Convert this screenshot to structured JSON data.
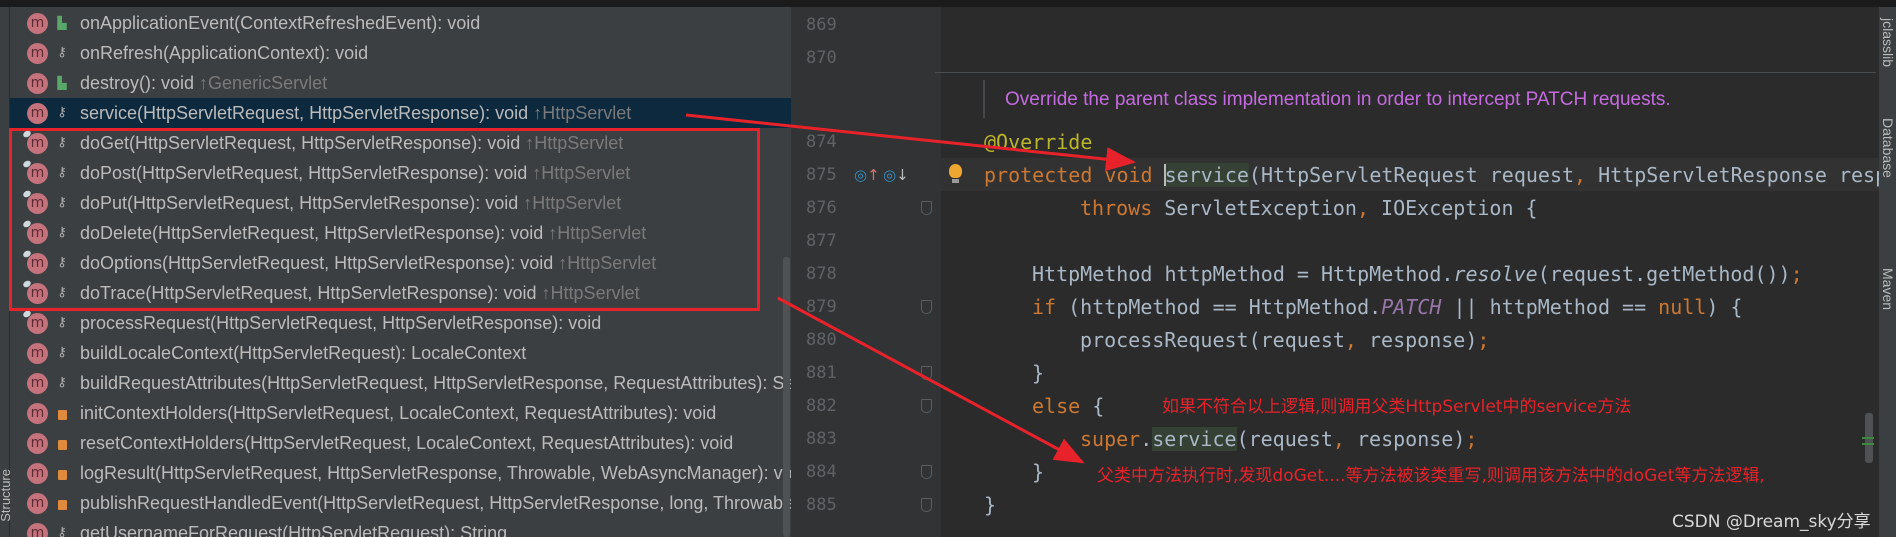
{
  "structure": {
    "side_tab": "Structure",
    "items": [
      {
        "name": "onApplicationEvent(ContextRefreshedEvent): void",
        "inherited": "",
        "access": "public",
        "overrides": false
      },
      {
        "name": "onRefresh(ApplicationContext): void",
        "inherited": "",
        "access": "protected",
        "overrides": false
      },
      {
        "name": "destroy(): void ",
        "inherited": "↑GenericServlet",
        "access": "public",
        "overrides": false
      },
      {
        "name": "service(HttpServletRequest, HttpServletResponse): void ",
        "inherited": "↑HttpServlet",
        "access": "protected",
        "overrides": false,
        "selected": true
      },
      {
        "name": "doGet(HttpServletRequest, HttpServletResponse): void ",
        "inherited": "↑HttpServlet",
        "access": "protected",
        "overrides": true
      },
      {
        "name": "doPost(HttpServletRequest, HttpServletResponse): void ",
        "inherited": "↑HttpServlet",
        "access": "protected",
        "overrides": true
      },
      {
        "name": "doPut(HttpServletRequest, HttpServletResponse): void ",
        "inherited": "↑HttpServlet",
        "access": "protected",
        "overrides": true
      },
      {
        "name": "doDelete(HttpServletRequest, HttpServletResponse): void ",
        "inherited": "↑HttpServlet",
        "access": "protected",
        "overrides": true
      },
      {
        "name": "doOptions(HttpServletRequest, HttpServletResponse): void ",
        "inherited": "↑HttpServlet",
        "access": "protected",
        "overrides": true
      },
      {
        "name": "doTrace(HttpServletRequest, HttpServletResponse): void ",
        "inherited": "↑HttpServlet",
        "access": "protected",
        "overrides": true
      },
      {
        "name": "processRequest(HttpServletRequest, HttpServletResponse): void",
        "inherited": "",
        "access": "protected",
        "overrides": true
      },
      {
        "name": "buildLocaleContext(HttpServletRequest): LocaleContext",
        "inherited": "",
        "access": "protected",
        "overrides": false
      },
      {
        "name": "buildRequestAttributes(HttpServletRequest, HttpServletResponse, RequestAttributes): ServletRequestAttributes",
        "inherited": "",
        "access": "protected",
        "overrides": false
      },
      {
        "name": "initContextHolders(HttpServletRequest, LocaleContext, RequestAttributes): void",
        "inherited": "",
        "access": "private",
        "overrides": false
      },
      {
        "name": "resetContextHolders(HttpServletRequest, LocaleContext, RequestAttributes): void",
        "inherited": "",
        "access": "private",
        "overrides": false
      },
      {
        "name": "logResult(HttpServletRequest, HttpServletResponse, Throwable, WebAsyncManager): void",
        "inherited": "",
        "access": "private",
        "overrides": false
      },
      {
        "name": "publishRequestHandledEvent(HttpServletRequest, HttpServletResponse, long, Throwable): void",
        "inherited": "",
        "access": "private",
        "overrides": false
      },
      {
        "name": "getUsernameForRequest(HttpServletRequest): String",
        "inherited": "",
        "access": "protected",
        "overrides": false
      }
    ]
  },
  "editor": {
    "doc_comment": "Override the parent class implementation in order to intercept PATCH requests.",
    "line_numbers": [
      {
        "n": "869",
        "row": 0
      },
      {
        "n": "870",
        "row": 1
      },
      {
        "n": "874",
        "row": 3.5
      },
      {
        "n": "875",
        "row": 4.5
      },
      {
        "n": "876",
        "row": 5.5
      },
      {
        "n": "877",
        "row": 6.5
      },
      {
        "n": "878",
        "row": 7.5
      },
      {
        "n": "879",
        "row": 8.5
      },
      {
        "n": "880",
        "row": 9.5
      },
      {
        "n": "881",
        "row": 10.5
      },
      {
        "n": "882",
        "row": 11.5
      },
      {
        "n": "883",
        "row": 12.5
      },
      {
        "n": "884",
        "row": 13.5
      },
      {
        "n": "885",
        "row": 14.5
      }
    ],
    "code": [
      {
        "row": 3.5,
        "indent": 0,
        "tokens": [
          [
            "@Override",
            "ann"
          ]
        ]
      },
      {
        "row": 4.5,
        "indent": 0,
        "tokens": [
          [
            "protected void ",
            "kw"
          ],
          [
            "service",
            "hl"
          ],
          [
            "(HttpServletRequest request",
            "id"
          ],
          [
            ", ",
            "kw"
          ],
          [
            "HttpServletResponse response",
            "id"
          ]
        ]
      },
      {
        "row": 5.5,
        "indent": 2,
        "tokens": [
          [
            "throws ",
            "kw"
          ],
          [
            "ServletException",
            "id"
          ],
          [
            ", ",
            "kw"
          ],
          [
            "IOException {",
            "id"
          ]
        ]
      },
      {
        "row": 7.5,
        "indent": 1,
        "tokens": [
          [
            "HttpMethod httpMethod = HttpMethod.",
            "id"
          ],
          [
            "resolve",
            "mit"
          ],
          [
            "(request.getMethod())",
            "id"
          ],
          [
            ";",
            "kw"
          ]
        ]
      },
      {
        "row": 8.5,
        "indent": 1,
        "tokens": [
          [
            "if ",
            "kw"
          ],
          [
            "(httpMethod == HttpMethod.",
            "id"
          ],
          [
            "PATCH",
            "it"
          ],
          [
            " || httpMethod == ",
            "id"
          ],
          [
            "null",
            "kw"
          ],
          [
            ") {",
            "id"
          ]
        ]
      },
      {
        "row": 9.5,
        "indent": 2,
        "tokens": [
          [
            "processRequest(request",
            "id"
          ],
          [
            ", ",
            "kw"
          ],
          [
            "response)",
            "id"
          ],
          [
            ";",
            "kw"
          ]
        ]
      },
      {
        "row": 10.5,
        "indent": 1,
        "tokens": [
          [
            "}",
            "id"
          ]
        ]
      },
      {
        "row": 11.5,
        "indent": 1,
        "tokens": [
          [
            "else ",
            "kw"
          ],
          [
            "{",
            "id"
          ]
        ]
      },
      {
        "row": 12.5,
        "indent": 2,
        "tokens": [
          [
            "super",
            "kw"
          ],
          [
            ".",
            "id"
          ],
          [
            "service",
            "hl"
          ],
          [
            "(request",
            "id"
          ],
          [
            ", ",
            "kw"
          ],
          [
            "response)",
            "id"
          ],
          [
            ";",
            "kw"
          ]
        ]
      },
      {
        "row": 13.5,
        "indent": 1,
        "tokens": [
          [
            "}",
            "id"
          ]
        ]
      },
      {
        "row": 14.5,
        "indent": 0,
        "tokens": [
          [
            "}",
            "id"
          ]
        ]
      }
    ]
  },
  "right_tool_tabs": [
    "jclasslib",
    "Database",
    "Maven"
  ],
  "annotations": {
    "note_else": "如果不符合以上逻辑,则调用父类HttpServlet中的service方法",
    "note_doget": "父类中方法执行时,发现doGet....等方法被该类重写,则调用该方法中的doGet等方法逻辑,",
    "color": "#e8222a"
  },
  "watermark": "CSDN @Dream_sky分享",
  "colors": {
    "keyword": "#cc7832",
    "annotation": "#bbb529",
    "comment_doc": "#c56be0",
    "selected_row": "#0d293e",
    "panel": "#3c3f41",
    "editor": "#2b2b2b"
  }
}
